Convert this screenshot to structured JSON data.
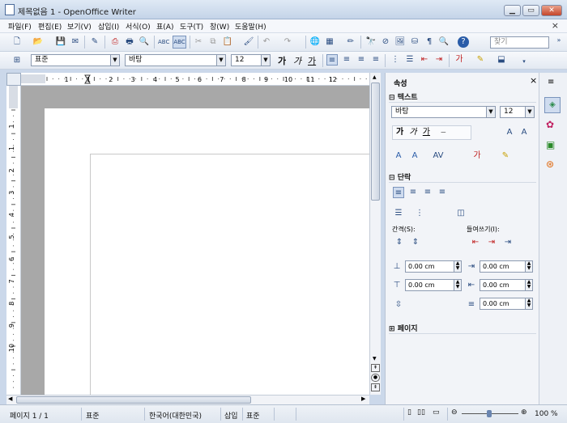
{
  "window": {
    "title": "제목없음 1 - OpenOffice Writer"
  },
  "menu": [
    "파일(F)",
    "편집(E)",
    "보기(V)",
    "삽입(I)",
    "서식(O)",
    "표(A)",
    "도구(T)",
    "창(W)",
    "도움말(H)"
  ],
  "menu_close": "×",
  "toolbar1": {
    "find_placeholder": "찾기"
  },
  "toolbar2": {
    "style": "표준",
    "font": "바탕",
    "size": "12",
    "bold": "가",
    "italic": "가",
    "underline": "가"
  },
  "ruler": {
    "h_ticks": [
      "1",
      "1",
      "2",
      "3",
      "4",
      "5",
      "6",
      "7",
      "8",
      "9",
      "10",
      "11",
      "12"
    ],
    "v_ticks": [
      "1",
      "1",
      "2",
      "3",
      "4",
      "5",
      "6",
      "7",
      "8",
      "9",
      "10"
    ]
  },
  "sidebar": {
    "title": "속성",
    "close": "×",
    "text_panel": {
      "title": "텍스트",
      "font": "바탕",
      "size": "12",
      "bold": "가",
      "italic": "가",
      "underline": "가",
      "strike": "ᄊ",
      "shadow": "가"
    },
    "paragraph_panel": {
      "title": "단락",
      "spacing_label": "간격(S):",
      "indent_label": "들여쓰기(I):",
      "above": "0.00 cm",
      "before": "0.00 cm",
      "below": "0.00 cm",
      "after": "0.00 cm",
      "first": "0.00 cm"
    },
    "page_panel": {
      "title": "페이지"
    }
  },
  "status": {
    "page": "페이지 1 / 1",
    "style": "표준",
    "language": "한국어(대한민국)",
    "mode": "삽입",
    "selection": "표준",
    "zoom": "100 %"
  }
}
